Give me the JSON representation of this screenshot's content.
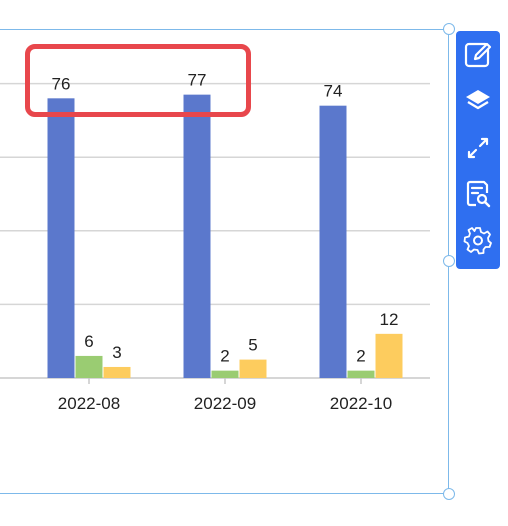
{
  "chart_data": {
    "type": "bar",
    "categories": [
      "2022-08",
      "2022-09",
      "2022-10"
    ],
    "series": [
      {
        "values": [
          76,
          77,
          74
        ],
        "color": "#5b78cc"
      },
      {
        "values": [
          6,
          2,
          2
        ],
        "color": "#9acc72"
      },
      {
        "values": [
          3,
          5,
          12
        ],
        "color": "#fdcc5e"
      }
    ],
    "data_labels": [
      [
        "76",
        "77",
        "74"
      ],
      [
        "6",
        "2",
        "2"
      ],
      [
        "3",
        "5",
        "12"
      ]
    ],
    "ylim": [
      0,
      80
    ],
    "grid": true,
    "legend": "none",
    "title": "",
    "xlabel": "",
    "ylabel": ""
  },
  "toolbar": {
    "items": [
      {
        "icon": "edit-icon"
      },
      {
        "icon": "layers-icon"
      },
      {
        "icon": "expand-icon"
      },
      {
        "icon": "data-view-icon"
      },
      {
        "icon": "settings-icon"
      }
    ]
  },
  "colors": {
    "toolbar_bg": "#2f6ff0",
    "selection": "#7db9ea",
    "highlight": "#e8474c",
    "grid": "#d6d6d6"
  }
}
